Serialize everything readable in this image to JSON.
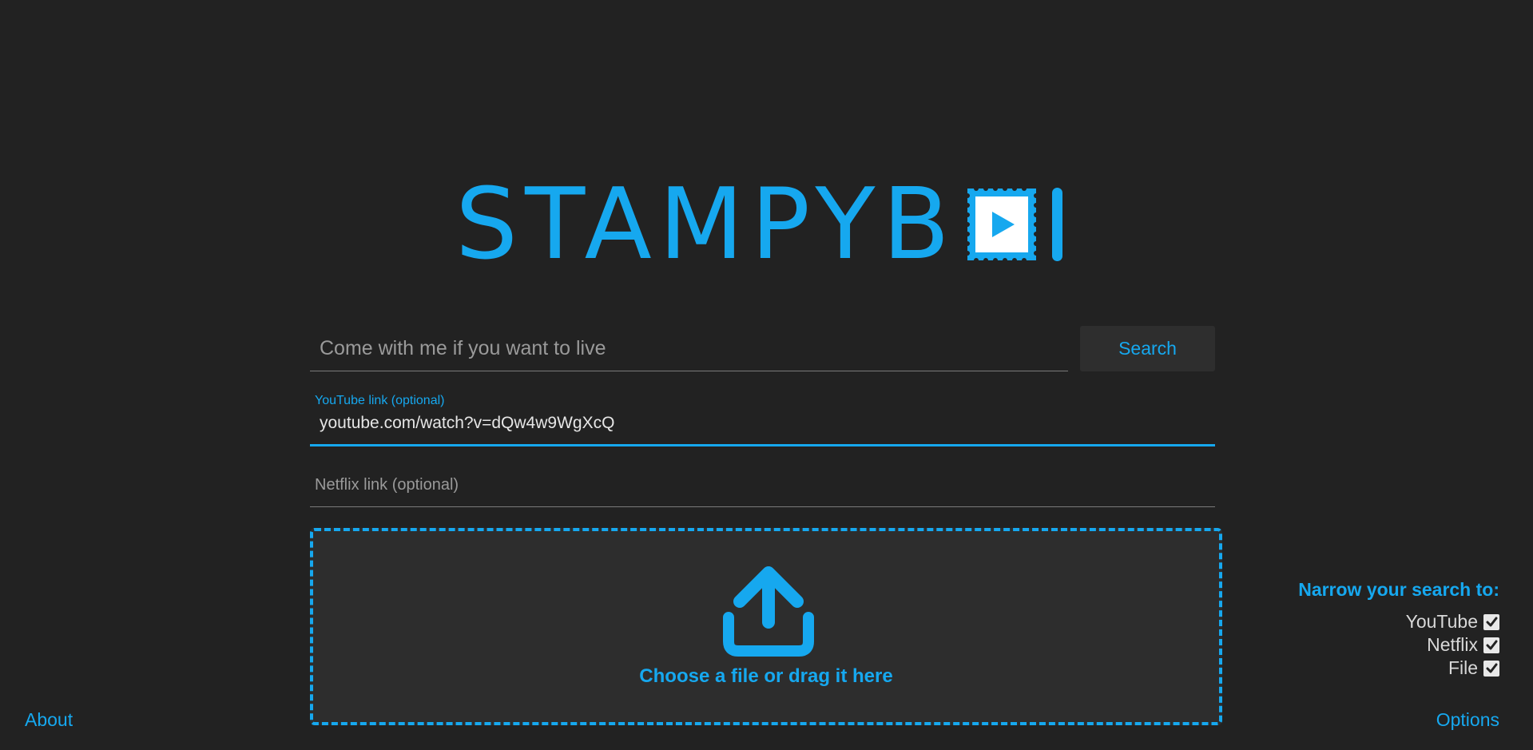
{
  "logo": {
    "text": "STAMPYB",
    "alt": "STAMPYBOI"
  },
  "search": {
    "placeholder": "Come with me if you want to live",
    "value": "",
    "button_label": "Search"
  },
  "youtube_field": {
    "label": "YouTube link (optional)",
    "value": "youtube.com/watch?v=dQw4w9WgXcQ"
  },
  "netflix_field": {
    "placeholder": "Netflix link (optional)",
    "value": ""
  },
  "dropzone": {
    "text": "Choose a file or drag it here",
    "icon": "upload-icon"
  },
  "narrow": {
    "title": "Narrow your search to:",
    "options": [
      {
        "label": "YouTube",
        "checked": true
      },
      {
        "label": "Netflix",
        "checked": true
      },
      {
        "label": "File",
        "checked": true
      }
    ]
  },
  "footer": {
    "about_label": "About",
    "options_label": "Options"
  },
  "colors": {
    "accent": "#16a8ef",
    "background": "#222222",
    "panel": "#2d2d2d"
  }
}
